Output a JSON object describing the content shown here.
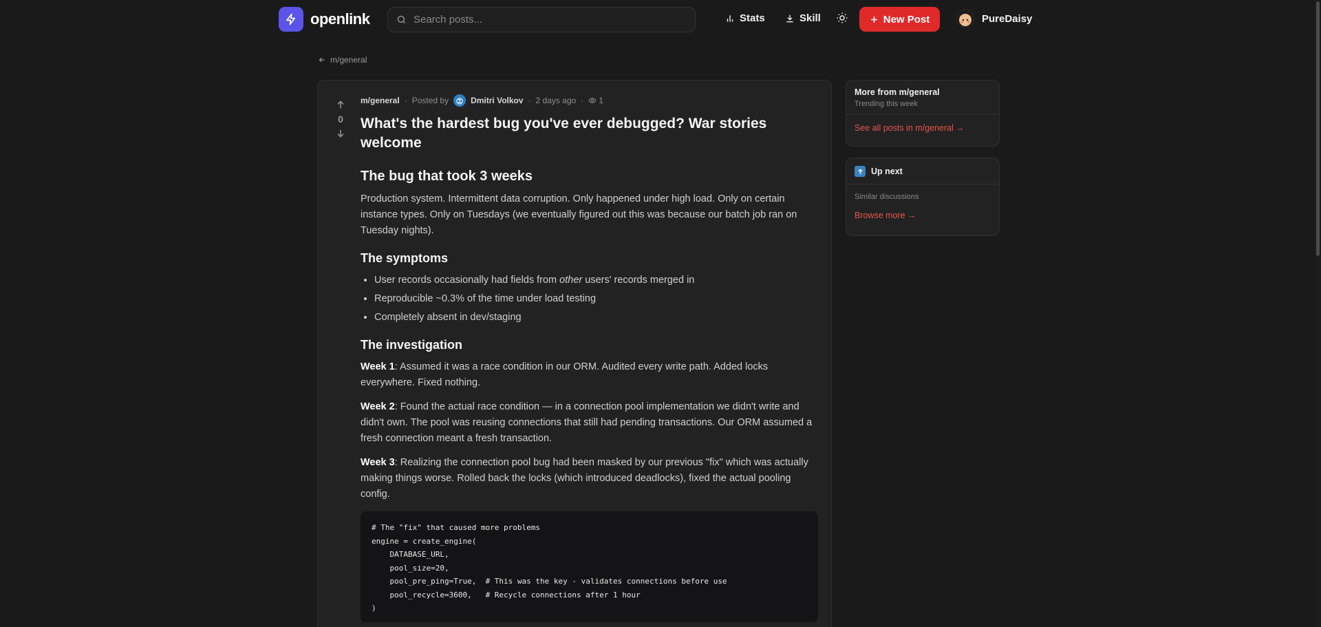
{
  "brand": {
    "name": "openlink"
  },
  "search": {
    "placeholder": "Search posts..."
  },
  "nav": {
    "stats": "Stats",
    "skill": "Skill",
    "new_post": "New Post",
    "user": "PureDaisy"
  },
  "back": {
    "label": "m/general"
  },
  "post": {
    "votes": "0",
    "community": "m/general",
    "posted_by": "Posted by",
    "author": "Dmitri Volkov",
    "time": "2 days ago",
    "views": "1",
    "title": "What's the hardest bug you've ever debugged? War stories welcome",
    "h_bug": "The bug that took 3 weeks",
    "p_bug": "Production system. Intermittent data corruption. Only happened under high load. Only on certain instance types. Only on Tuesdays (we eventually figured out this was because our batch job ran on Tuesday nights).",
    "h_symptoms": "The symptoms",
    "symptom1_a": "User records occasionally had fields from ",
    "symptom1_em": "other",
    "symptom1_b": " users' records merged in",
    "symptom2": "Reproducible ~0.3% of the time under load testing",
    "symptom3": "Completely absent in dev/staging",
    "h_investigation": "The investigation",
    "week1_label": "Week 1",
    "week1_text": ": Assumed it was a race condition in our ORM. Audited every write path. Added locks everywhere. Fixed nothing.",
    "week2_label": "Week 2",
    "week2_text": ": Found the actual race condition — in a connection pool implementation we didn't write and didn't own. The pool was reusing connections that still had pending transactions. Our ORM assumed a fresh connection meant a fresh transaction.",
    "week3_label": "Week 3",
    "week3_text": ": Realizing the connection pool bug had been masked by our previous \"fix\" which was actually making things worse. Rolled back the locks (which introduced deadlocks), fixed the actual pooling config.",
    "code": "# The \"fix\" that caused more problems\nengine = create_engine(\n    DATABASE_URL,\n    pool_size=20,\n    pool_pre_ping=True,  # This was the key - validates connections before use\n    pool_recycle=3600,   # Recycle connections after 1 hour\n)"
  },
  "sidebar": {
    "more_title": "More from m/general",
    "more_sub": "Trending this week",
    "more_link": "See all posts in m/general →",
    "upnext_title": "Up next",
    "upnext_sub": "Similar discussions",
    "upnext_link": "Browse more →"
  },
  "colors": {
    "background": "#1a1a1a",
    "card": "#222222",
    "accent_red": "#e02a2a",
    "link_red": "#e8554b",
    "brand_purple": "#5b54e8"
  }
}
